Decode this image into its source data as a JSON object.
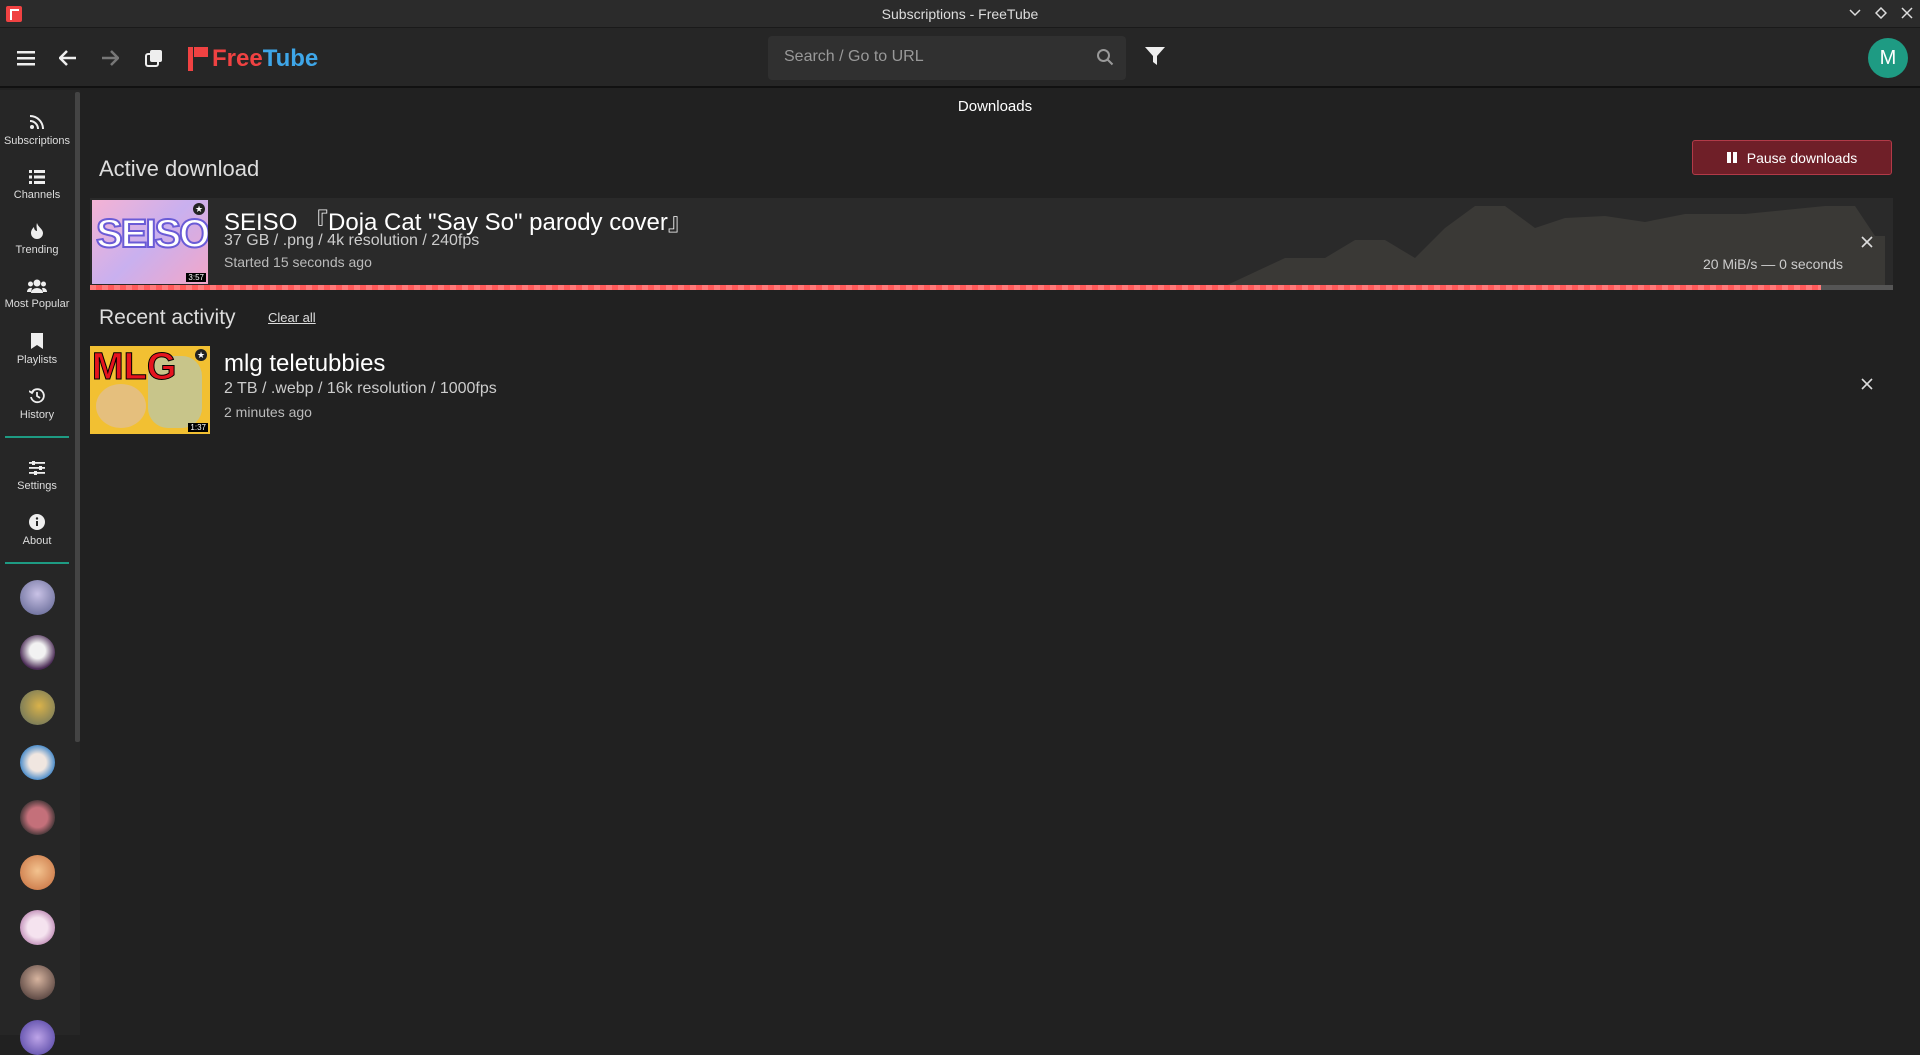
{
  "window": {
    "title": "Subscriptions - FreeTube"
  },
  "brand": {
    "free": "Free",
    "tube": "Tube"
  },
  "search": {
    "placeholder": "Search / Go to URL"
  },
  "user": {
    "initial": "M"
  },
  "sidebar": {
    "items": [
      {
        "label": "Subscriptions",
        "icon": "rss-icon"
      },
      {
        "label": "Channels",
        "icon": "list-icon"
      },
      {
        "label": "Trending",
        "icon": "fire-icon"
      },
      {
        "label": "Most Popular",
        "icon": "users-icon"
      },
      {
        "label": "Playlists",
        "icon": "bookmark-icon"
      },
      {
        "label": "History",
        "icon": "history-icon"
      },
      {
        "label": "Settings",
        "icon": "sliders-icon"
      },
      {
        "label": "About",
        "icon": "info-icon"
      }
    ]
  },
  "page": {
    "title": "Downloads"
  },
  "active": {
    "heading": "Active download",
    "pause_label": "Pause downloads",
    "item": {
      "title": "SEISO 『Doja Cat \"Say So\" parody cover』",
      "meta": "37 GB / .png / 4k resolution / 240fps",
      "started": "Started 15 seconds ago",
      "speed": "20 MiB/s — 0 seconds",
      "thumb_text": "SEISO",
      "duration": "3:57",
      "progress": 0.96
    }
  },
  "recent": {
    "heading": "Recent activity",
    "clear_label": "Clear all",
    "items": [
      {
        "title": "mlg teletubbies",
        "meta": "2 TB / .webp / 16k resolution / 1000fps",
        "time": "2 minutes ago",
        "thumb_text": "MLG",
        "duration": "1:37"
      }
    ]
  },
  "colors": {
    "accent": "#1e9b83",
    "danger": "#b23a48",
    "brand_red": "#f04242",
    "brand_blue": "#3ea6e8"
  }
}
